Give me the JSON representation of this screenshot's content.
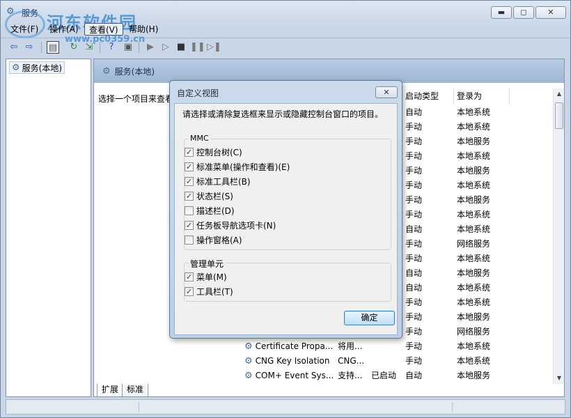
{
  "window": {
    "title": "服务",
    "watermark": "河东软件园",
    "watermark_url": "www.pc0359.cn",
    "buttons": {
      "minimize": "▬",
      "restore": "◻",
      "close": "✕"
    }
  },
  "menu": {
    "items": [
      "文件(F)",
      "操作(A)",
      "查看(V)",
      "帮助(H)"
    ]
  },
  "tree": {
    "root": "服务(本地)"
  },
  "pane": {
    "header": "服务(本地)",
    "description": "选择一个项目来查看",
    "columns": [
      "启动类型",
      "登录为"
    ],
    "rows": [
      {
        "startup": "自动",
        "logon": "本地系统"
      },
      {
        "startup": "手动",
        "logon": "本地系统"
      },
      {
        "startup": "手动",
        "logon": "本地服务"
      },
      {
        "startup": "手动",
        "logon": "本地系统"
      },
      {
        "startup": "手动",
        "logon": "本地服务"
      },
      {
        "startup": "手动",
        "logon": "本地系统"
      },
      {
        "startup": "手动",
        "logon": "本地服务"
      },
      {
        "startup": "手动",
        "logon": "本地系统"
      },
      {
        "startup": "自动",
        "logon": "本地系统"
      },
      {
        "startup": "手动",
        "logon": "网络服务"
      },
      {
        "startup": "手动",
        "logon": "本地系统"
      },
      {
        "startup": "自动",
        "logon": "本地服务"
      },
      {
        "startup": "自动",
        "logon": "本地系统"
      },
      {
        "startup": "手动",
        "logon": "本地系统"
      },
      {
        "startup": "手动",
        "logon": "本地服务"
      },
      {
        "startup": "手动",
        "logon": "网络服务"
      },
      {
        "name": "Certificate Propa...",
        "desc": "将用...",
        "status": "",
        "startup": "手动",
        "logon": "本地系统"
      },
      {
        "name": "CNG Key Isolation",
        "desc": "CNG...",
        "status": "",
        "startup": "手动",
        "logon": "本地系统"
      },
      {
        "name": "COM+ Event Sys...",
        "desc": "支持...",
        "status": "已启动",
        "startup": "自动",
        "logon": "本地服务"
      }
    ],
    "tabs": [
      "扩展",
      "标准"
    ]
  },
  "dialog": {
    "title": "自定义视图",
    "close": "✕",
    "instruction": "请选择或清除复选框来显示或隐藏控制台窗口的项目。",
    "group_mmc": "MMC",
    "mmc_options": [
      {
        "label": "控制台树(C)",
        "checked": true
      },
      {
        "label": "标准菜单(操作和查看)(E)",
        "checked": true
      },
      {
        "label": "标准工具栏(B)",
        "checked": true
      },
      {
        "label": "状态栏(S)",
        "checked": true
      },
      {
        "label": "描述栏(D)",
        "checked": false
      },
      {
        "label": "任务板导航选项卡(N)",
        "checked": true
      },
      {
        "label": "操作窗格(A)",
        "checked": false
      }
    ],
    "group_snapin": "管理单元",
    "snapin_options": [
      {
        "label": "菜单(M)",
        "checked": true
      },
      {
        "label": "工具栏(T)",
        "checked": true
      }
    ],
    "ok": "确定"
  }
}
